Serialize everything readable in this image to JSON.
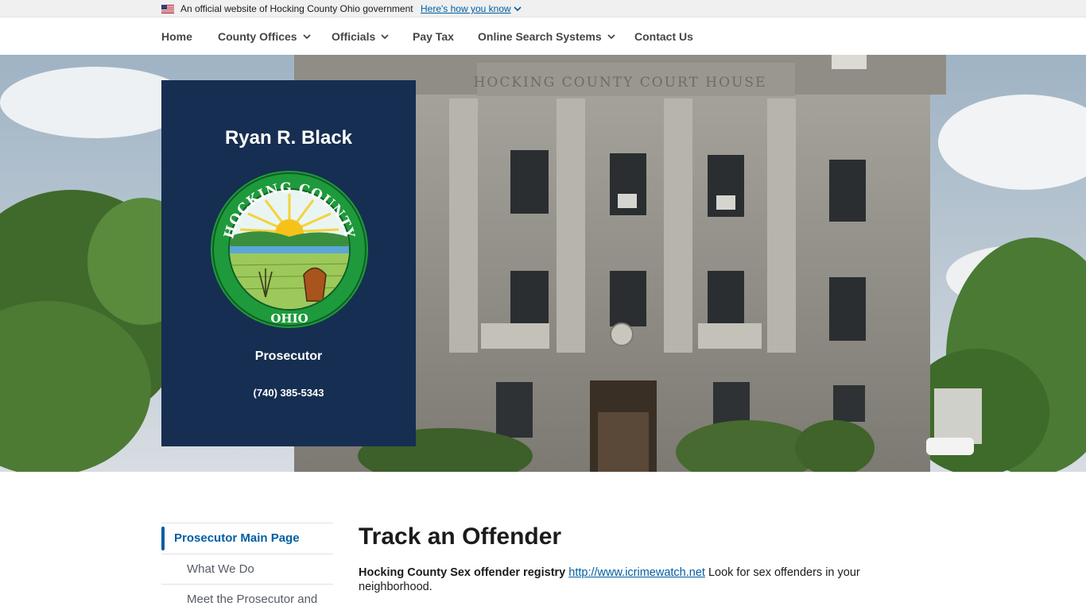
{
  "banner": {
    "official_text": "An official website of Hocking County Ohio government",
    "howto_link": "Here's how you know"
  },
  "nav": {
    "items": [
      {
        "label": "Home"
      },
      {
        "label": "County Offices"
      },
      {
        "label": "Officials"
      },
      {
        "label": "Pay Tax"
      },
      {
        "label": "Online Search Systems"
      },
      {
        "label": "Contact Us"
      }
    ]
  },
  "hero": {
    "building_inscription": "HOCKING COUNTY COURT HOUSE",
    "card": {
      "name": "Ryan R. Black",
      "seal_top_text": "HOCKING COUNTY",
      "seal_bottom_text": "OHIO",
      "role": "Prosecutor",
      "phone": "(740) 385-5343"
    }
  },
  "sidenav": {
    "items": [
      {
        "label": "Prosecutor Main Page"
      },
      {
        "label": "What We Do"
      },
      {
        "label": "Meet the Prosecutor and"
      }
    ]
  },
  "main": {
    "title": "Track an Offender",
    "registry_label": "Hocking County Sex offender registry",
    "registry_link": "http://www.icrimewatch.net",
    "registry_text_before_break": " Look for sex offenders in your",
    "registry_text_after_break": "neighborhood."
  },
  "colors": {
    "card_bg": "#162e51",
    "link": "#005ea2",
    "seal_green": "#1e9a3c"
  }
}
